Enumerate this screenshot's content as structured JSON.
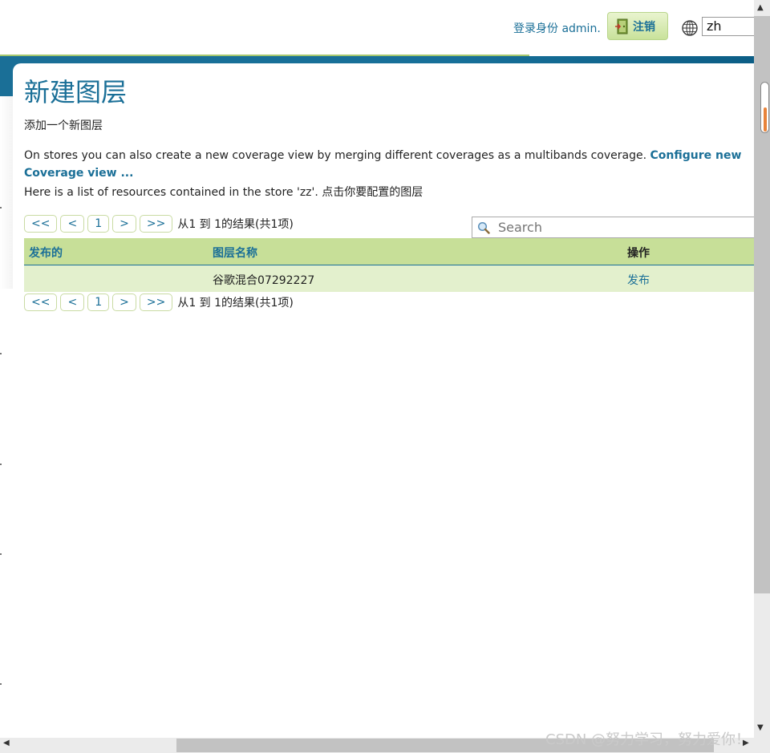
{
  "header": {
    "login_text": "登录身份 admin.",
    "logout_label": "注销",
    "language_value": "zh"
  },
  "page": {
    "title": "新建图层",
    "subtitle": "添加一个新图层",
    "description_text": "On stores you can also create a new coverage view by merging different coverages as a multibands coverage.",
    "description_link": "Configure new Coverage view ...",
    "resources_text": "Here is a list of resources contained in the store 'zz'. 点击你要配置的图层"
  },
  "pager": {
    "first": "<<",
    "prev": "<",
    "page": "1",
    "next": ">",
    "last": ">>",
    "summary": "从1 到 1的结果(共1项)"
  },
  "search": {
    "placeholder": "Search"
  },
  "table": {
    "columns": [
      "发布的",
      "图层名称",
      "操作"
    ],
    "rows": [
      {
        "published": "",
        "layer_name": "谷歌混合07292227",
        "action": "发布"
      }
    ]
  },
  "watermark": "CSDN @努力学习，努力爱你！",
  "colors": {
    "accent": "#1a6f97",
    "header_row": "#c7df98",
    "data_row": "#e3f0cd"
  }
}
